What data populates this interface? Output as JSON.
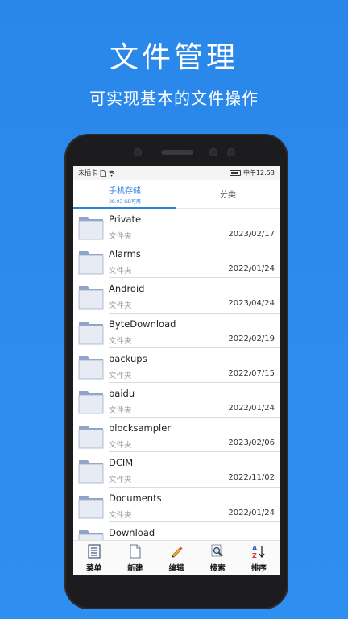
{
  "promo": {
    "title": "文件管理",
    "subtitle": "可实现基本的文件操作"
  },
  "status_bar": {
    "carrier": "未插卡",
    "sim_icon": "sim-icon",
    "wifi_icon": "wifi-icon",
    "battery_icon": "battery-icon",
    "time": "中午12:53"
  },
  "tabs": [
    {
      "label": "手机存储",
      "sub": "38.93 GB可用",
      "active": true
    },
    {
      "label": "分类",
      "sub": "",
      "active": false
    }
  ],
  "files": [
    {
      "name": "Private",
      "type": "文件夹",
      "date": "2023/02/17"
    },
    {
      "name": "Alarms",
      "type": "文件夹",
      "date": "2022/01/24"
    },
    {
      "name": "Android",
      "type": "文件夹",
      "date": "2023/04/24"
    },
    {
      "name": "ByteDownload",
      "type": "文件夹",
      "date": "2022/02/19"
    },
    {
      "name": "backups",
      "type": "文件夹",
      "date": "2022/07/15"
    },
    {
      "name": "baidu",
      "type": "文件夹",
      "date": "2022/01/24"
    },
    {
      "name": "blocksampler",
      "type": "文件夹",
      "date": "2023/02/06"
    },
    {
      "name": "DCIM",
      "type": "文件夹",
      "date": "2022/11/02"
    },
    {
      "name": "Documents",
      "type": "文件夹",
      "date": "2022/01/24"
    },
    {
      "name": "Download",
      "type": "",
      "date": ""
    }
  ],
  "toolbar": [
    {
      "label": "菜单",
      "icon": "menu-list-icon"
    },
    {
      "label": "新建",
      "icon": "new-file-icon"
    },
    {
      "label": "编辑",
      "icon": "edit-pencil-icon"
    },
    {
      "label": "搜索",
      "icon": "search-magnifier-icon"
    },
    {
      "label": "排序",
      "icon": "sort-az-icon"
    }
  ],
  "colors": {
    "background": "#2f8ff0",
    "accent": "#2f7fe0",
    "phone_frame": "#1c1c1e"
  }
}
